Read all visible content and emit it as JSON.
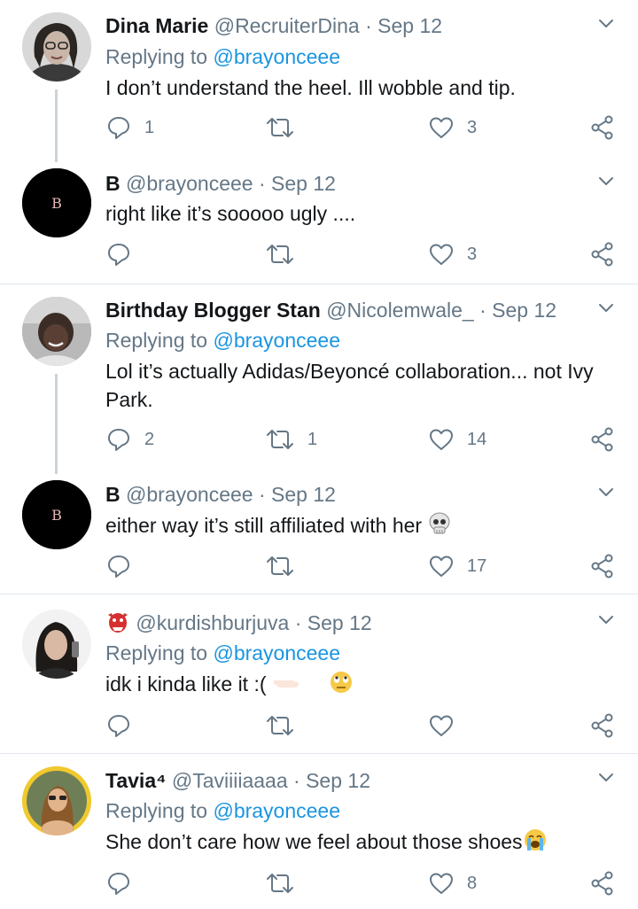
{
  "tweets": [
    {
      "name": "Dina Marie",
      "handle": "@RecruiterDina",
      "date": "Sep 12",
      "replying_label": "Replying to",
      "replying_to": "@brayonceee",
      "text": "I don’t understand the heel. Ill wobble and tip.",
      "replies": "1",
      "retweets": "",
      "likes": "3"
    },
    {
      "name": "B",
      "handle": "@brayonceee",
      "date": "Sep 12",
      "text": "right like it’s sooooo ugly ....",
      "replies": "",
      "retweets": "",
      "likes": "3"
    },
    {
      "name": "Birthday Blogger Stan",
      "handle": "@Nicolemwale_",
      "date": "Sep 12",
      "replying_label": "Replying to",
      "replying_to": "@brayonceee",
      "text": "Lol it’s actually Adidas/Beyoncé collaboration...  not Ivy Park.",
      "replies": "2",
      "retweets": "1",
      "likes": "14"
    },
    {
      "name": "B",
      "handle": "@brayonceee",
      "date": "Sep 12",
      "text": "either way it’s still affiliated with her ",
      "text_emoji": "skull-emoji",
      "replies": "",
      "retweets": "",
      "likes": "17"
    },
    {
      "name_emoji": "goblin-emoji",
      "handle": "@kurdishburjuva",
      "date": "Sep 12",
      "replying_label": "Replying to",
      "replying_to": "@brayonceee",
      "text": "idk i kinda like it :( ",
      "text_emoji": "pointing-hands-eyeroll-emoji",
      "replies": "",
      "retweets": "",
      "likes": ""
    },
    {
      "name": "Tavia",
      "name_suffix": "⁴",
      "handle": "@Taviiiiaaaa",
      "date": "Sep 12",
      "replying_label": "Replying to",
      "replying_to": "@brayonceee",
      "text": "She don’t care how we feel about those shoes",
      "text_emoji": "crying-face-emoji",
      "replies": "",
      "retweets": "",
      "likes": "8"
    }
  ],
  "avatar_letter": "B",
  "colors": {
    "text": "#14171a",
    "muted": "#657786",
    "link": "#1b95e0",
    "thread_line": "#cdd3d8",
    "divider": "#e1e8ed"
  },
  "icons": [
    "reply-icon",
    "retweet-icon",
    "like-icon",
    "share-icon",
    "chevron-down-icon"
  ]
}
